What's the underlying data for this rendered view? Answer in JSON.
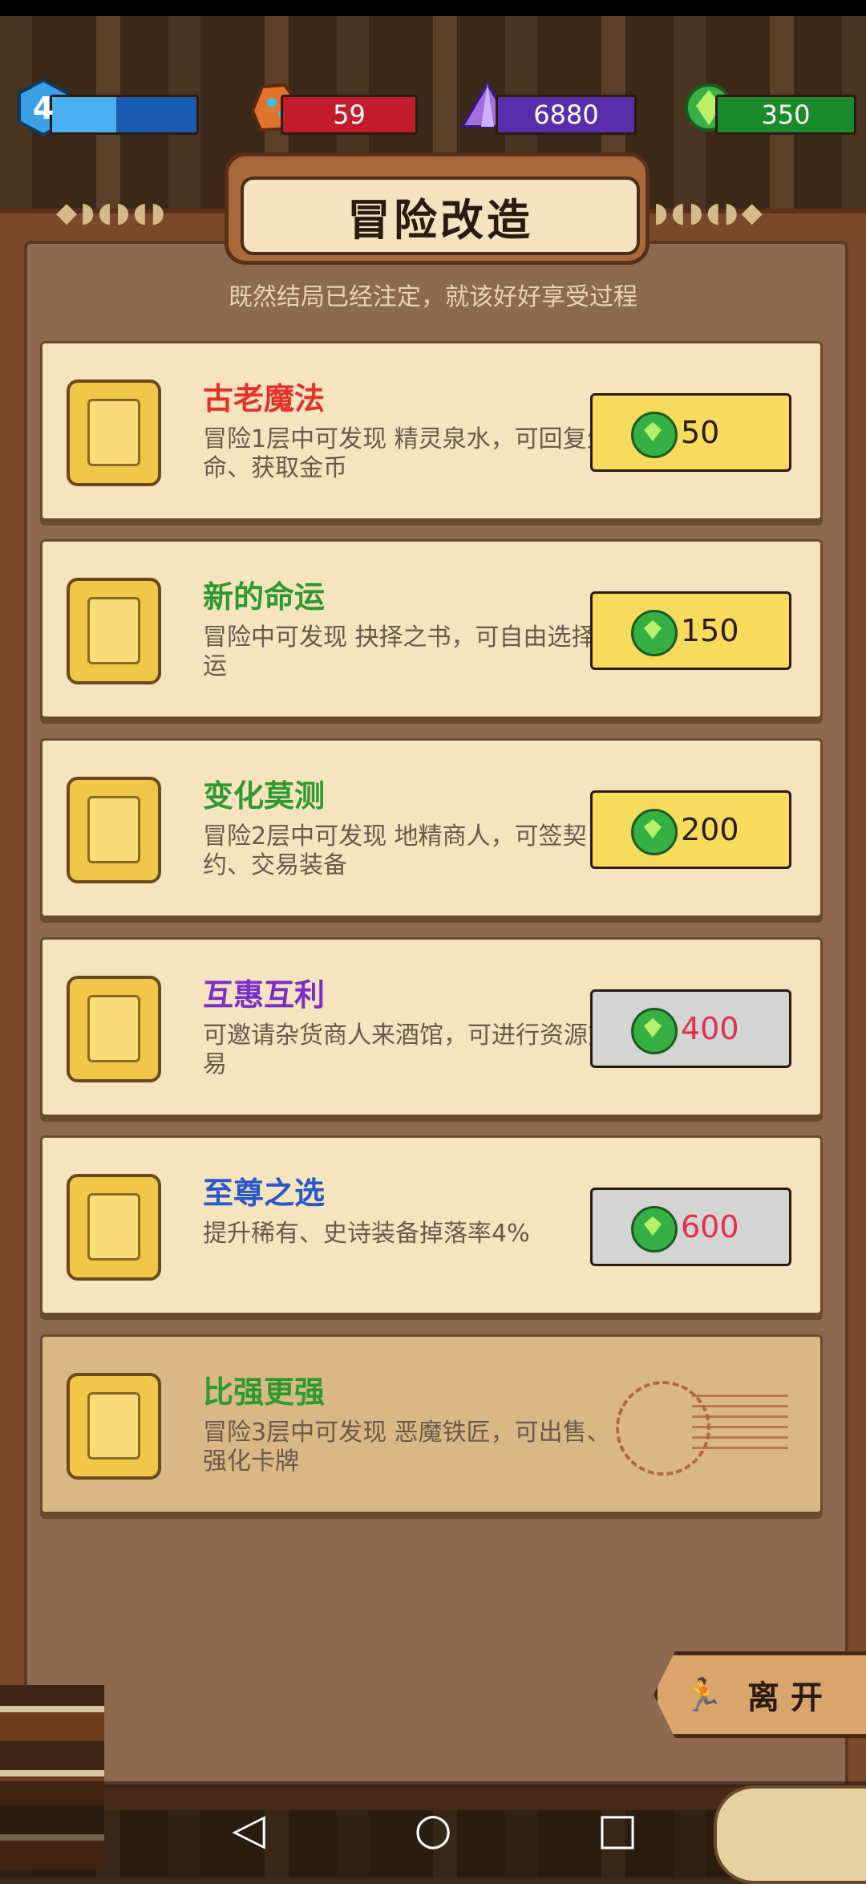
{
  "resources": {
    "level": "4",
    "ore": "59",
    "crystal": "6880",
    "gems": "350"
  },
  "header": {
    "title": "冒险改造",
    "subtitle": "既然结局已经注定，就该好好享受过程"
  },
  "cards": [
    {
      "title": "古老魔法",
      "title_color": "#e2322a",
      "desc": "冒险1层中可发现 精灵泉水，可回复生命、获取金币",
      "price": "50",
      "price_color": "#2a1a10",
      "price_style": "yellow",
      "icon": "fountain-icon"
    },
    {
      "title": "新的命运",
      "title_color": "#2e9a2e",
      "desc": "冒险中可发现 抉择之书，可自由选择命运",
      "price": "150",
      "price_color": "#2a1a10",
      "price_style": "yellow",
      "icon": "book-icon"
    },
    {
      "title": "变化莫测",
      "title_color": "#2e9a2e",
      "desc": "冒险2层中可发现 地精商人，可签契约、交易装备",
      "price": "200",
      "price_color": "#2a1a10",
      "price_style": "yellow",
      "icon": "contract-icon"
    },
    {
      "title": "互惠互利",
      "title_color": "#7a2ec8",
      "desc": "可邀请杂货商人来酒馆，可进行资源交易",
      "price": "400",
      "price_color": "#e0304a",
      "price_style": "grey",
      "icon": "top-hat-icon"
    },
    {
      "title": "至尊之选",
      "title_color": "#2a58c8",
      "desc": "提升稀有、史诗装备掉落率4%",
      "price": "600",
      "price_color": "#e0304a",
      "price_style": "grey",
      "icon": "dice-icon"
    },
    {
      "title": "比强更强",
      "title_color": "#2e9a2e",
      "desc": "冒险3层中可发现 恶魔铁匠，可出售、强化卡牌",
      "price": "",
      "price_color": "",
      "price_style": "stamp",
      "icon": "scroll-icon"
    }
  ],
  "leave_button": {
    "label": "离开",
    "icon": "running-man-icon"
  },
  "nav": {
    "back": "◁",
    "home": "○",
    "recent": "□"
  }
}
